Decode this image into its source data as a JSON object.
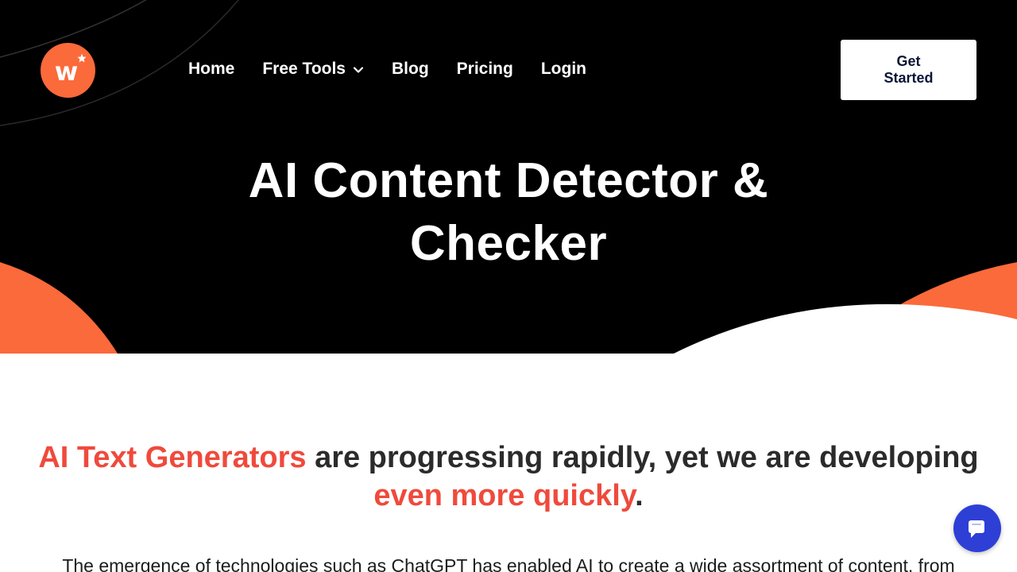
{
  "brand": {
    "logo_letter": "w"
  },
  "nav": {
    "items": [
      "Home",
      "Free Tools",
      "Blog",
      "Pricing",
      "Login"
    ]
  },
  "header": {
    "cta_label": "Get Started"
  },
  "hero": {
    "title": "AI Content Detector & Checker"
  },
  "tagline": {
    "highlight_1": "AI Text Generators",
    "middle": " are progressing rapidly, yet we are developing ",
    "highlight_2": "even more quickly",
    "end": "."
  },
  "intro": {
    "text": "The emergence of technologies such as ChatGPT has enabled AI to create a wide assortment of content, from"
  },
  "icons": {
    "logo": "logo-star-icon",
    "free_tools": "chevron-down-icon",
    "chat": "chat-bubble-icon"
  },
  "colors": {
    "hero_bg": "#000000",
    "accent_orange": "#fb6a3a",
    "accent_red": "#ef4a3c",
    "cta_text": "#0b1536",
    "chat_blue": "#2e3fd6"
  }
}
